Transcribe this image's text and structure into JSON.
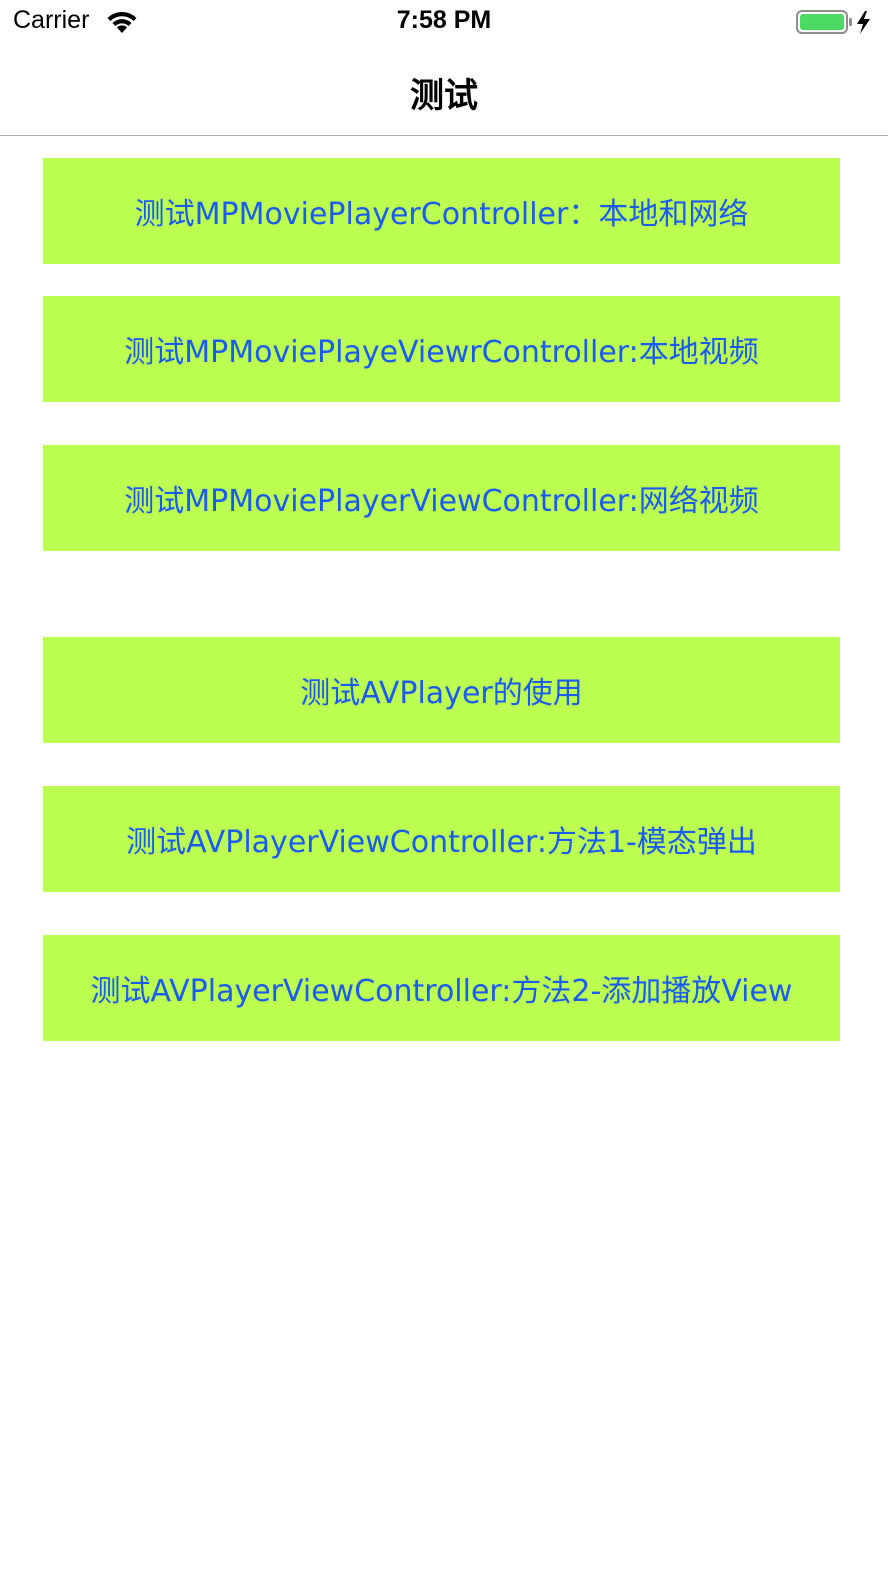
{
  "status_bar": {
    "carrier": "Carrier",
    "time": "7:58 PM",
    "wifi_icon": "wifi-icon",
    "battery_icon": "battery-charging-icon",
    "battery_color": "#4cd964"
  },
  "nav": {
    "title": "测试"
  },
  "buttons": [
    {
      "label": "测试MPMoviePlayerController：本地和网络"
    },
    {
      "label": "测试MPMoviePlayeViewrController:本地视频"
    },
    {
      "label": "测试MPMoviePlayerViewController:网络视频"
    },
    {
      "label": "测试AVPlayer的使用"
    },
    {
      "label": "测试AVPlayerViewController:方法1-模态弹出"
    },
    {
      "label": "测试AVPlayerViewController:方法2-添加播放View"
    }
  ],
  "colors": {
    "button_bg": "#bcff50",
    "button_text": "#1a5cf0"
  }
}
